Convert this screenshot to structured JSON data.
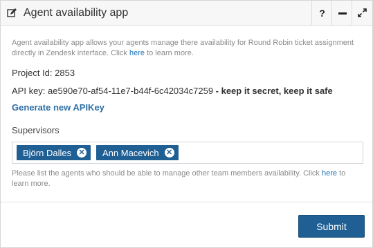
{
  "header": {
    "title": "Agent availability app",
    "help_label": "?",
    "icons": {
      "edit": "edit-icon",
      "minimize": "minimize-icon",
      "expand": "expand-icon"
    }
  },
  "description": {
    "text": "Agent availability app allows your agents manage there availability for Round Robin ticket assignment directly in Zendesk interface. Click ",
    "link": "here",
    "suffix": " to learn more."
  },
  "project": {
    "label": "Project Id: ",
    "value": "2853"
  },
  "api": {
    "label": "API key: ",
    "key": "ae590e70-af54-11e7-b44f-6c42034c7259",
    "note": " - keep it secret, keep it safe"
  },
  "generate_label": "Generate new APIKey",
  "supervisors": {
    "label": "Supervisors",
    "tags": [
      {
        "name": "Björn Dalles"
      },
      {
        "name": "Ann Macevich"
      }
    ]
  },
  "hint": {
    "text": "Please list the agents who should be able to manage other team members availability. Click ",
    "link": "here",
    "suffix": " to learn more."
  },
  "submit_label": "Submit",
  "colors": {
    "accent": "#1f5f94",
    "link": "#1f73b7"
  }
}
